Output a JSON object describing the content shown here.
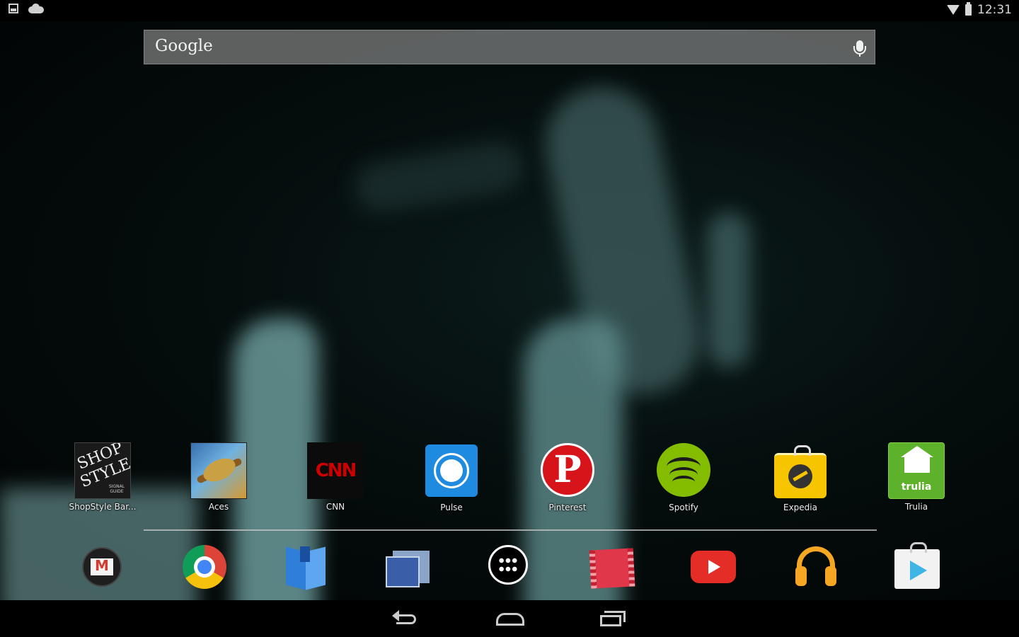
{
  "status_bar": {
    "left_icons": [
      "screenshot-icon",
      "cloud-upload-icon"
    ],
    "right_icons": [
      "wifi-icon",
      "battery-icon"
    ],
    "time": "12:31"
  },
  "search": {
    "logo_text": "Google",
    "mic_icon": "microphone-icon"
  },
  "apps": [
    {
      "label": "ShopStyle Bar...",
      "icon": "shopstyle-icon",
      "icon_text_1": "SHOP",
      "icon_text_2": "STYLE",
      "icon_text_3": "SIGNAL GUIDE"
    },
    {
      "label": "Aces",
      "icon": "aces-plane-icon"
    },
    {
      "label": "CNN",
      "icon": "cnn-icon",
      "icon_text": "CNN"
    },
    {
      "label": "Pulse",
      "icon": "pulse-icon"
    },
    {
      "label": "Pinterest",
      "icon": "pinterest-icon",
      "icon_text": "P"
    },
    {
      "label": "Spotify",
      "icon": "spotify-icon"
    },
    {
      "label": "Expedia",
      "icon": "expedia-icon"
    },
    {
      "label": "Trulia",
      "icon": "trulia-icon",
      "icon_text": "trulia"
    }
  ],
  "dock": [
    {
      "icon": "gmail-icon"
    },
    {
      "icon": "chrome-icon"
    },
    {
      "icon": "play-books-icon"
    },
    {
      "icon": "gallery-icon"
    },
    {
      "icon": "all-apps-icon"
    },
    {
      "icon": "play-movies-icon"
    },
    {
      "icon": "youtube-icon"
    },
    {
      "icon": "play-music-icon"
    },
    {
      "icon": "play-store-icon"
    }
  ],
  "nav": {
    "buttons": [
      "back-icon",
      "home-icon",
      "recents-icon"
    ]
  },
  "colors": {
    "pulse": "#1f8be0",
    "pinterest": "#d8141b",
    "spotify": "#84bd00",
    "expedia": "#f7c400",
    "trulia": "#5eb12b",
    "youtube": "#e52d27"
  }
}
